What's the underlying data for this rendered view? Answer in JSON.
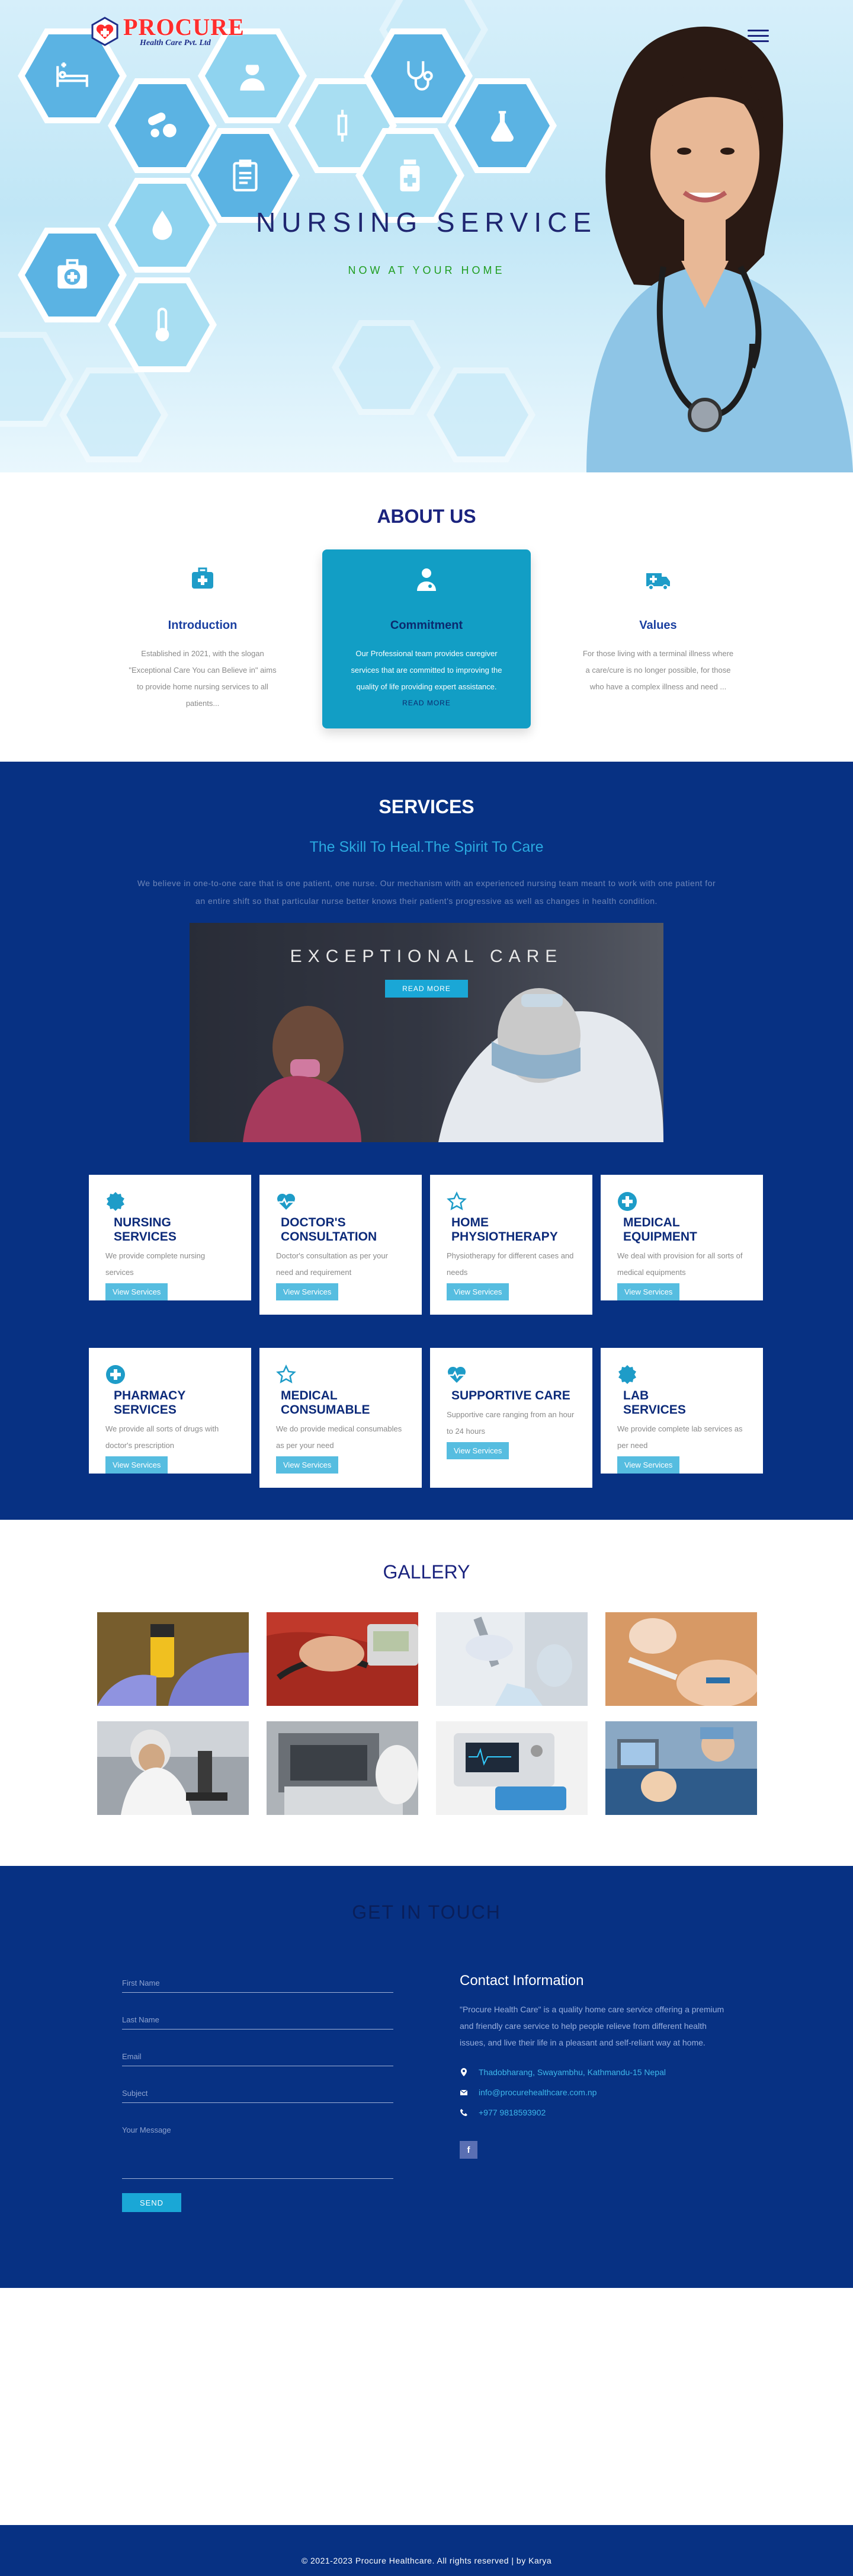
{
  "brand": {
    "name": "PROCURE",
    "sub": "Health Care Pvt. Ltd"
  },
  "hero": {
    "title": "NURSING SERVICE",
    "subtitle": "NOW AT YOUR HOME"
  },
  "about": {
    "title": "ABOUT US",
    "cards": [
      {
        "title": "Introduction",
        "text": "Established in 2021, with the slogan \"Exceptional Care You can Believe in\" aims to provide home nursing services to all patients..."
      },
      {
        "title": "Commitment",
        "text": "Our Professional team provides caregiver services that are committed to improving the quality of life providing expert assistance.",
        "link": "READ MORE"
      },
      {
        "title": "Values",
        "text": "For those living with a terminal illness where a care/cure is no longer possible, for those who have a complex illness and need ..."
      }
    ]
  },
  "services": {
    "title": "SERVICES",
    "tagline": "The Skill To Heal.The Spirit To Care",
    "text": "We believe in one-to-one care that is one patient, one nurse. Our mechanism with an experienced nursing team meant to work with one patient for an entire shift so that particular nurse better knows their patient's progressive as well as changes in health condition.",
    "banner": {
      "title": "EXCEPTIONAL CARE",
      "button": "READ MORE"
    },
    "view_label": "View Services",
    "cards": [
      {
        "title": "NURSING SERVICES",
        "text": "We provide complete nursing services"
      },
      {
        "title": "DOCTOR'S CONSULTATION",
        "text": "Doctor's consultation as per your need and requirement"
      },
      {
        "title": "HOME PHYSIOTHERAPY",
        "text": "Physiotherapy for different cases and needs"
      },
      {
        "title": "MEDICAL EQUIPMENT",
        "text": "We deal with provision for all sorts of medical equipments"
      },
      {
        "title": "PHARMACY SERVICES",
        "text": "We provide all sorts of drugs with doctor's prescription"
      },
      {
        "title": "MEDICAL CONSUMABLE",
        "text": "We do provide medical consumables as per your need"
      },
      {
        "title": "SUPPORTIVE CARE",
        "text": "Supportive care ranging from an hour to 24 hours"
      },
      {
        "title": "LAB SERVICES",
        "text": "We provide complete lab services as per need"
      }
    ]
  },
  "gallery": {
    "title": "GALLERY"
  },
  "contact": {
    "title": "GET IN TOUCH",
    "placeholders": {
      "first": "First Name",
      "last": "Last Name",
      "email": "Email",
      "subject": "Subject",
      "message": "Your Message"
    },
    "send": "SEND",
    "info_title": "Contact Information",
    "info_text": "\"Procure Health Care\" is a quality home care service offering a premium and friendly care service to help people relieve from different health issues, and live their life in a pleasant and self-reliant way at home.",
    "address": "Thadobharang, Swayambhu, Kathmandu-15 Nepal",
    "email": "info@procurehealthcare.com.np",
    "phone": "+977 9818593902",
    "facebook": "f"
  },
  "footer": {
    "text": "© 2021-2023 Procure Healthcare. All rights reserved | by Karya"
  },
  "colors": {
    "navy": "#073183",
    "accent": "#129ec5",
    "heading": "#1a237e"
  }
}
